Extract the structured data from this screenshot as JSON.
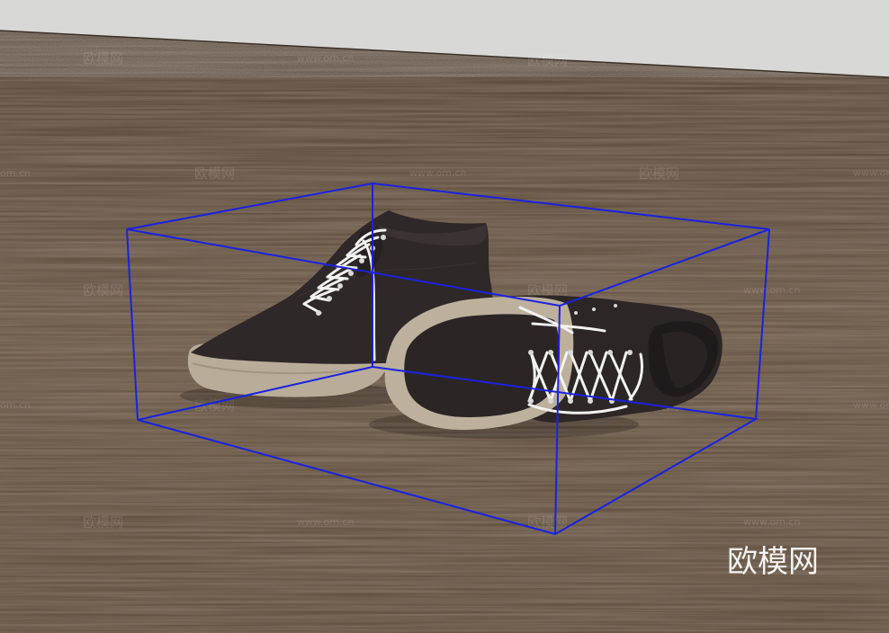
{
  "watermark": {
    "brand": "欧模网",
    "url": "www.om.cn",
    "url_short": "om.cn"
  },
  "colors": {
    "wall": "#d8d8d6",
    "floor": "#5e4c3c",
    "shoe_upper": "#2e2728",
    "sole": "#b8ab98",
    "laces": "#f2f2f2",
    "bounding_box": "#1a22e0"
  },
  "objects": [
    "shoe-upright",
    "shoe-tipped",
    "bounding-box"
  ]
}
